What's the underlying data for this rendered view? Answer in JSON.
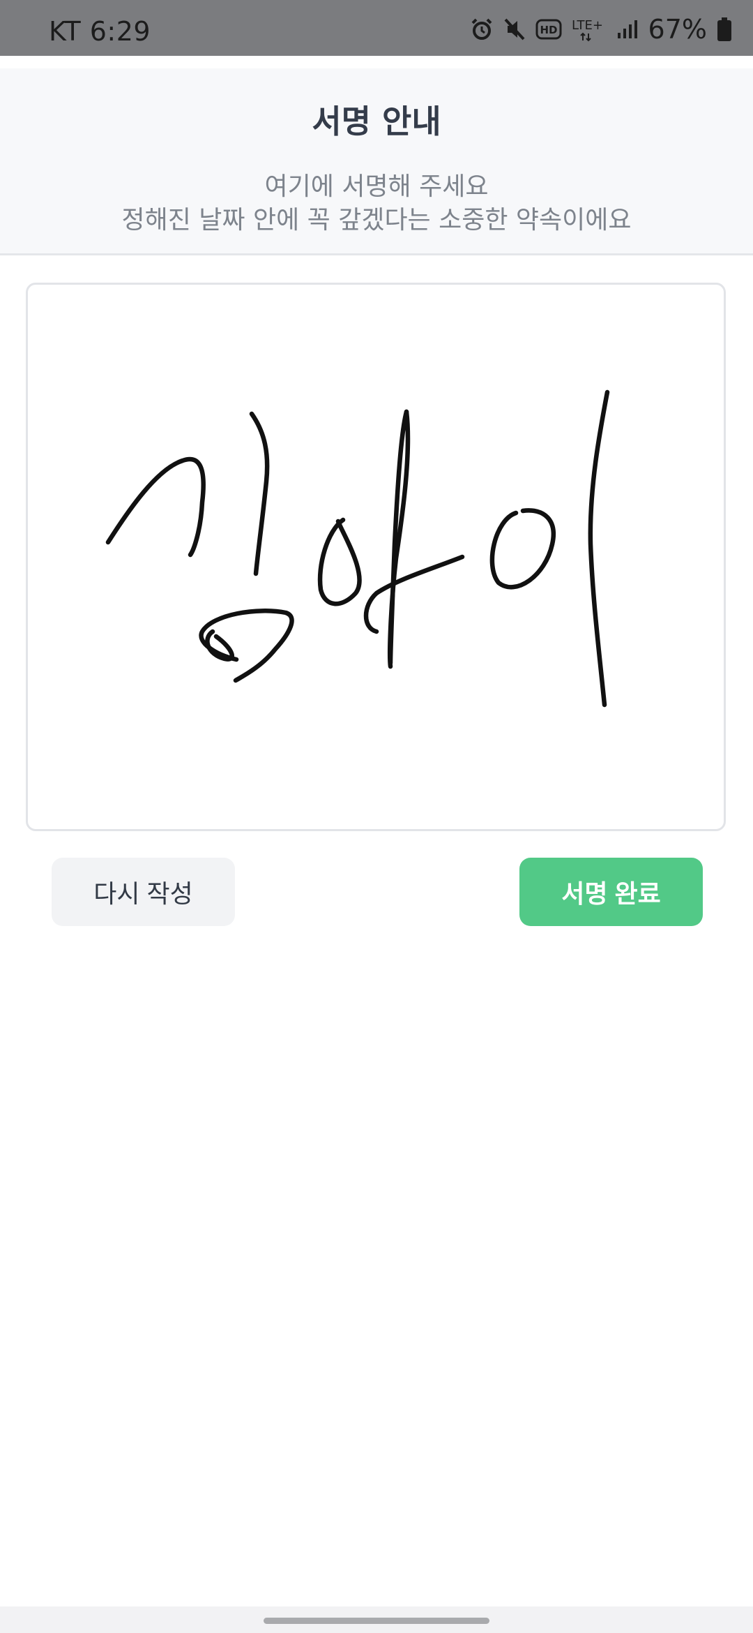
{
  "status_bar": {
    "carrier_time": "KT 6:29",
    "battery_percent": "67%",
    "network_label": "LTE+",
    "hd_label": "HD",
    "icons": [
      "alarm-icon",
      "mute-icon",
      "hd-voice-icon",
      "lte-icon",
      "signal-icon",
      "battery-icon"
    ]
  },
  "guide": {
    "title": "서명 안내",
    "line1": "여기에 서명해 주세요",
    "line2": "정해진 날짜 안에 꼭 갚겠다는 소중한 약속이에요"
  },
  "signature": {
    "drawn": true,
    "stroke_color": "#111111"
  },
  "buttons": {
    "rewrite_label": "다시 작성",
    "complete_label": "서명 완료"
  },
  "colors": {
    "accent_green": "#52c987",
    "status_bar_bg": "#7b7c7f"
  }
}
